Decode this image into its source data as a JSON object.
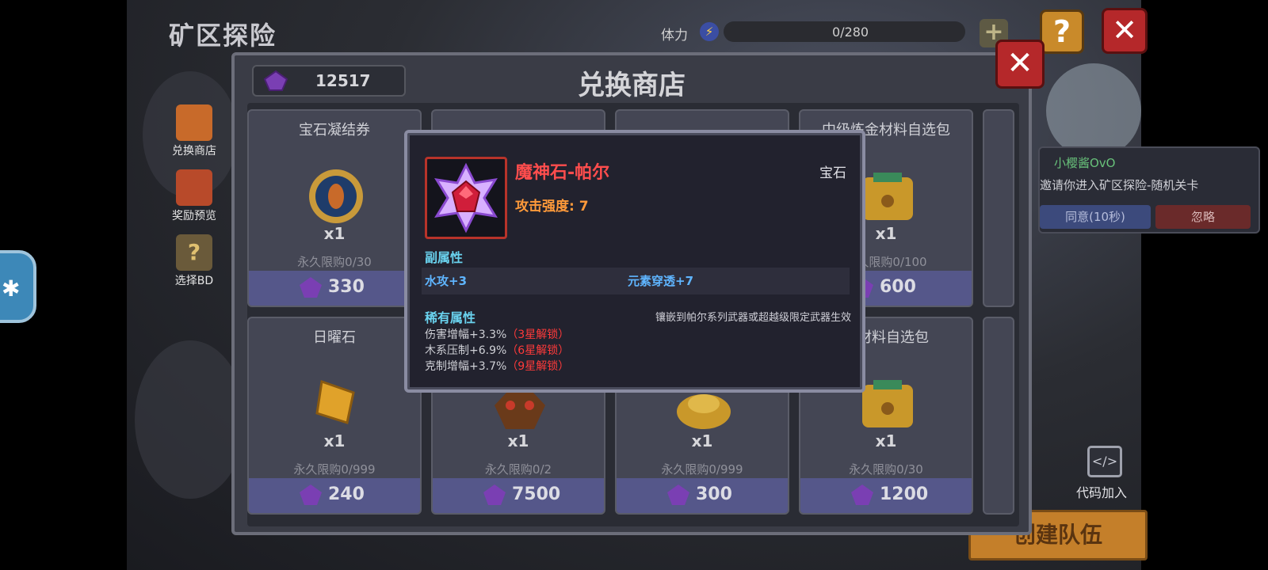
{
  "header": {
    "title": "矿区探险",
    "stamina_label": "体力",
    "stamina_value": "0/280"
  },
  "side_menu": [
    {
      "label": "兑换商店"
    },
    {
      "label": "奖励预览"
    },
    {
      "label": "选择BD"
    }
  ],
  "shop": {
    "title": "兑换商店",
    "gem_balance": "12517",
    "items": [
      {
        "name": "宝石凝结券",
        "qty": "x1",
        "limit": "永久限购0/30",
        "price": "330",
        "icon": "blue-coin-icon"
      },
      {
        "name": "",
        "qty": "",
        "limit": "",
        "price": "",
        "icon": ""
      },
      {
        "name": "",
        "qty": "",
        "limit": "",
        "price": "",
        "icon": ""
      },
      {
        "name": "中级炼金材料自选包",
        "qty": "x1",
        "limit": "永久限购0/100",
        "price": "600",
        "icon": "gold-chest-icon"
      },
      {
        "name": "日曜石",
        "qty": "x1",
        "limit": "永久限购0/999",
        "price": "240",
        "icon": "sun-stone-icon"
      },
      {
        "name": "",
        "qty": "x1",
        "limit": "永久限购0/2",
        "price": "7500",
        "icon": "brown-tree-icon"
      },
      {
        "name": "",
        "qty": "x1",
        "limit": "永久限购0/999",
        "price": "300",
        "icon": "gold-pile-icon"
      },
      {
        "name": "金材料自选包",
        "qty": "x1",
        "limit": "永久限购0/30",
        "price": "1200",
        "icon": "gold-chest-icon"
      }
    ]
  },
  "popup": {
    "item_name": "魔神石-帕尔",
    "item_type": "宝石",
    "attack": "攻击强度: 7",
    "sub_title": "副属性",
    "sub_attrs": [
      "水攻+3",
      "元素穿透+7"
    ],
    "rare_title": "稀有属性",
    "rare_note": "镶嵌到帕尔系列武器或超越级限定武器生效",
    "rare_attrs": [
      {
        "text": "伤害增幅+3.3%",
        "lock": "（3星解锁）"
      },
      {
        "text": "木系压制+6.9%",
        "lock": "（6星解锁）"
      },
      {
        "text": "克制增幅+3.7%",
        "lock": "（9星解锁）"
      }
    ]
  },
  "invite": {
    "user": "小樱酱OvO",
    "message": "邀请你进入矿区探险-随机关卡",
    "agree": "同意(10秒)",
    "ignore": "忽略"
  },
  "code_join": "代码加入",
  "create_team": "创建队伍"
}
